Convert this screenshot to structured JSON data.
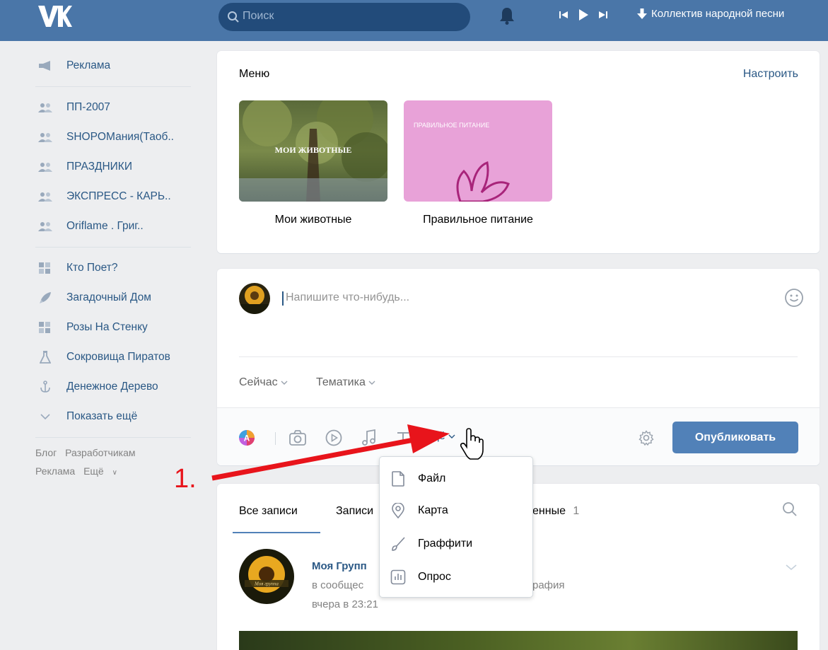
{
  "header": {
    "search_placeholder": "Поиск",
    "now_playing": "Коллектив народной песни"
  },
  "sidebar": {
    "items": [
      {
        "label": "Реклама",
        "icon": "megaphone-icon"
      },
      {
        "label": "ПП-2007",
        "icon": "group-icon"
      },
      {
        "label": "SHOPОМания(Таоб..",
        "icon": "group-icon"
      },
      {
        "label": "ПРАЗДНИКИ",
        "icon": "group-icon"
      },
      {
        "label": "ЭКСПРЕСС - КАРЬ..",
        "icon": "group-icon"
      },
      {
        "label": "Oriflame . Григ..",
        "icon": "group-icon"
      },
      {
        "label": "Кто Поет?",
        "icon": "apps-icon"
      },
      {
        "label": "Загадочный Дом",
        "icon": "rocket-icon"
      },
      {
        "label": "Розы На Стенку",
        "icon": "apps-icon"
      },
      {
        "label": "Сокровища Пиратов",
        "icon": "flask-icon"
      },
      {
        "label": "Денежное Дерево",
        "icon": "anchor-icon"
      },
      {
        "label": "Показать ещё",
        "icon": "chevron-down-icon"
      }
    ],
    "footer": {
      "blog": "Блог",
      "developers": "Разработчикам",
      "ads": "Реклама",
      "more": "Ещё"
    }
  },
  "menu": {
    "title": "Меню",
    "setup": "Настроить",
    "tiles": [
      {
        "label": "Мои животные",
        "overlay": "МОИ ЖИВОТНЫЕ"
      },
      {
        "label": "Правильное питание",
        "overlay": "ПРАВИЛЬНОЕ ПИТАНИЕ"
      }
    ]
  },
  "composer": {
    "placeholder": "Напишите что-нибудь...",
    "time_option": "Сейчас",
    "topic_option": "Тематика",
    "more": "Ещё",
    "publish": "Опубликовать"
  },
  "more_menu": {
    "items": [
      {
        "label": "Файл",
        "icon": "file-icon"
      },
      {
        "label": "Карта",
        "icon": "map-pin-icon"
      },
      {
        "label": "Граффити",
        "icon": "brush-icon"
      },
      {
        "label": "Опрос",
        "icon": "poll-icon"
      }
    ]
  },
  "feed": {
    "tabs": {
      "all": "Все записи",
      "community_partial": "Записи",
      "pinned_partial": "енные",
      "pinned_count": "1"
    },
    "post": {
      "author_partial": "Моя Групп",
      "sub_left": "в сообщес",
      "sub_right": "рафия",
      "time": "вчера в 23:21",
      "avatar_caption": "Моя группа"
    }
  },
  "annotation": {
    "step_label": "1."
  },
  "colors": {
    "header_bg": "#4a76a8",
    "link": "#2a5885",
    "button": "#5181b8",
    "annotation": "#e8141b"
  }
}
